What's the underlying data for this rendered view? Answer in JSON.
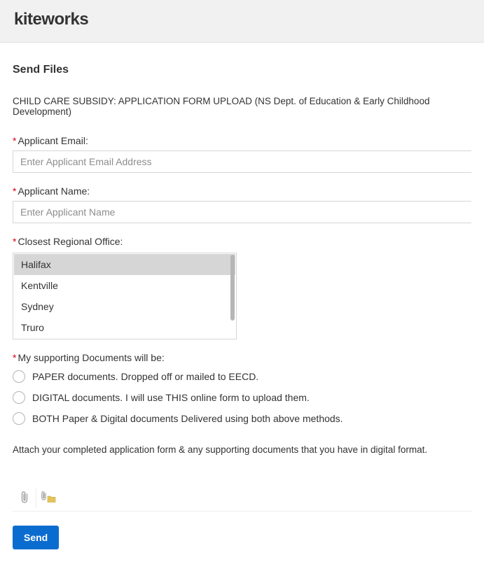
{
  "header": {
    "logo": "kiteworks"
  },
  "page": {
    "title": "Send Files",
    "subtitle": "CHILD CARE SUBSIDY: APPLICATION FORM UPLOAD (NS Dept. of Education & Early Childhood Development)"
  },
  "fields": {
    "email": {
      "label": "Applicant Email:",
      "placeholder": "Enter Applicant Email Address",
      "value": ""
    },
    "name": {
      "label": "Applicant Name:",
      "placeholder": "Enter Applicant Name",
      "value": ""
    },
    "office": {
      "label": "Closest Regional Office:",
      "selected": "Halifax",
      "options": [
        "Halifax",
        "Kentville",
        "Sydney",
        "Truro"
      ]
    },
    "documents": {
      "label": "My supporting Documents will be:",
      "options": [
        "PAPER documents. Dropped off or mailed to EECD.",
        "DIGITAL documents. I will use THIS online form to upload them.",
        "BOTH Paper & Digital documents Delivered using both above methods."
      ]
    }
  },
  "attach_text": "Attach your completed application form & any supporting documents that you have in digital format.",
  "buttons": {
    "send": "Send"
  }
}
